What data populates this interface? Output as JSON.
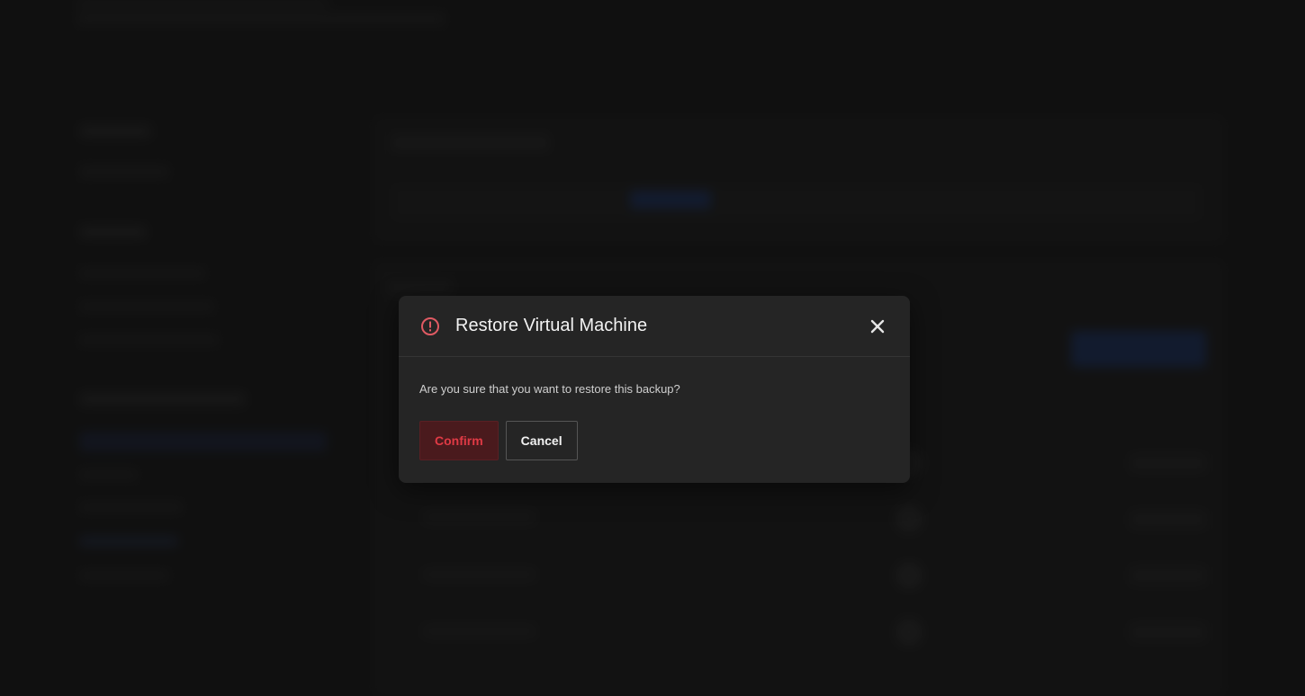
{
  "dialog": {
    "title": "Restore Virtual Machine",
    "message": "Are you sure that you want to restore this backup?",
    "confirm_label": "Confirm",
    "cancel_label": "Cancel",
    "header_icon": "alert-circle-icon",
    "close_icon": "close-icon"
  },
  "colors": {
    "danger": "#e03a45",
    "danger_bg": "#4a1a1d",
    "dialog_bg": "#252525",
    "backdrop": "#151515"
  }
}
